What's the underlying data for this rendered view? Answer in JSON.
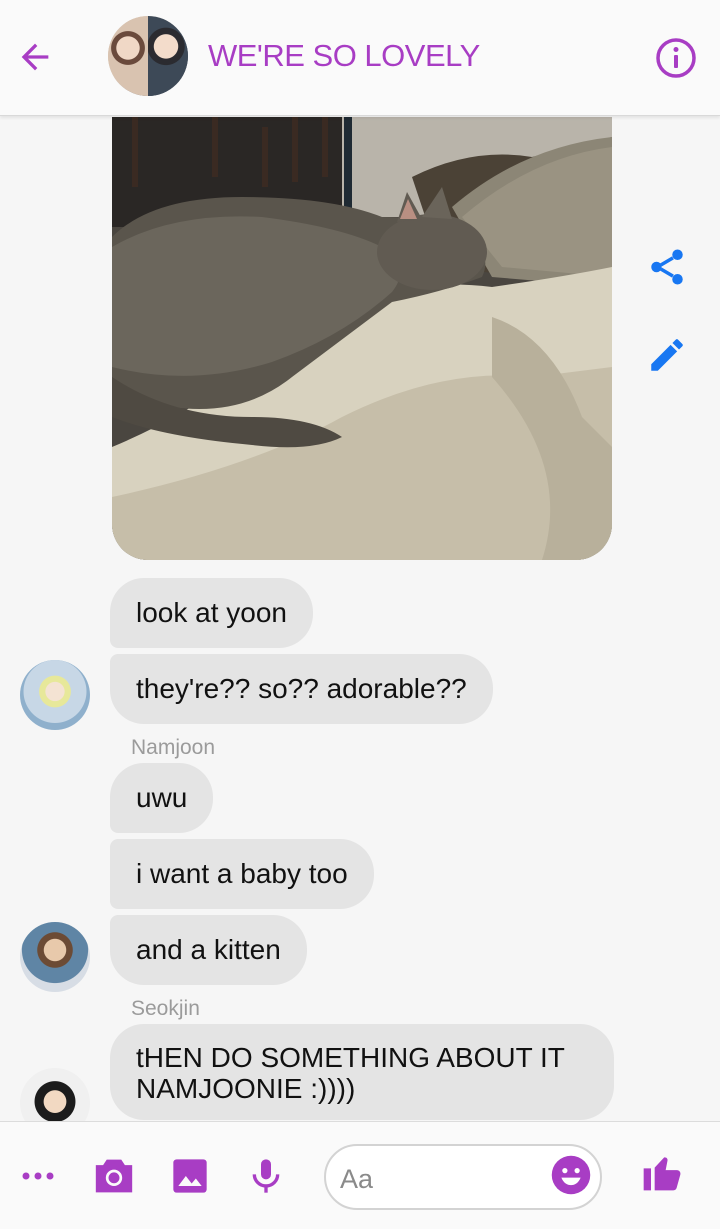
{
  "header": {
    "title": "WE'RE SO LOVELY",
    "back_icon": "arrow-left-icon",
    "info_icon": "info-icon",
    "accent_color": "#a83dc4"
  },
  "side_actions": {
    "share_icon": "share-icon",
    "edit_icon": "pencil-icon",
    "color": "#1877f2"
  },
  "messages": [
    {
      "text": "look at yoon"
    },
    {
      "text": "they're?? so?? adorable??"
    },
    {
      "sender": "Namjoon"
    },
    {
      "text": "uwu"
    },
    {
      "text": "i want a baby too"
    },
    {
      "text": "and a kitten"
    },
    {
      "sender": "Seokjin"
    },
    {
      "text": "tHEN DO SOMETHING ABOUT IT NAMJOONIE :))))"
    }
  ],
  "composer": {
    "placeholder": "Aa",
    "icons": [
      "more-icon",
      "camera-icon",
      "image-icon",
      "microphone-icon",
      "emoji-icon",
      "thumbs-up-icon"
    ]
  }
}
